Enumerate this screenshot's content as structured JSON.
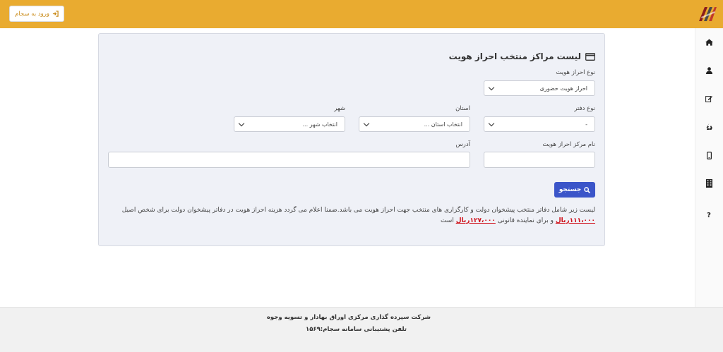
{
  "header": {
    "login_label": "ورود به سجام",
    "bg_color": "#e9ab30"
  },
  "sidebar": {
    "items": [
      {
        "icon": "home-icon"
      },
      {
        "icon": "user-icon"
      },
      {
        "icon": "edit-icon"
      },
      {
        "icon": "recycle-icon"
      },
      {
        "icon": "mobile-icon"
      },
      {
        "icon": "building-icon"
      },
      {
        "icon": "question-icon",
        "label": "?"
      }
    ]
  },
  "panel": {
    "title": "لیست مراکز منتخب احراز هویت",
    "auth_type": {
      "label": "نوع احراز هویت",
      "value": "احراز هویت حضوری"
    },
    "office_type": {
      "label": "نوع دفتر",
      "value": "-"
    },
    "province": {
      "label": "استان",
      "value": "انتخاب استان ..."
    },
    "city": {
      "label": "شهر",
      "value": "انتخاب شهر ..."
    },
    "center_name": {
      "label": "نام مرکز احراز هویت",
      "value": ""
    },
    "address": {
      "label": "آدرس",
      "value": ""
    },
    "search_label": "جستجو",
    "notice": {
      "text1": "لیست زیر شامل دفاتر منتخب پیشخوان دولت و کارگزاری های منتخب جهت احراز هویت می باشد.ضمنا اعلام می گردد هزینه احراز هویت در دفاتر پیشخوان دولت برای شخص اصیل",
      "price1": "۱۱۱،۰۰۰ریال",
      "text2": "و برای نماینده قانونی",
      "price2": "۱۲۷،۰۰۰ریال",
      "text3": "است"
    },
    "accent_color": "#3b55c9"
  },
  "footer": {
    "company": "شرکت سپرده گذاری مرکزی اوراق بهادار و تسویه وجوه",
    "phone": "تلفن پشتیبانی سامانه سجام:۱۵۶۹"
  }
}
